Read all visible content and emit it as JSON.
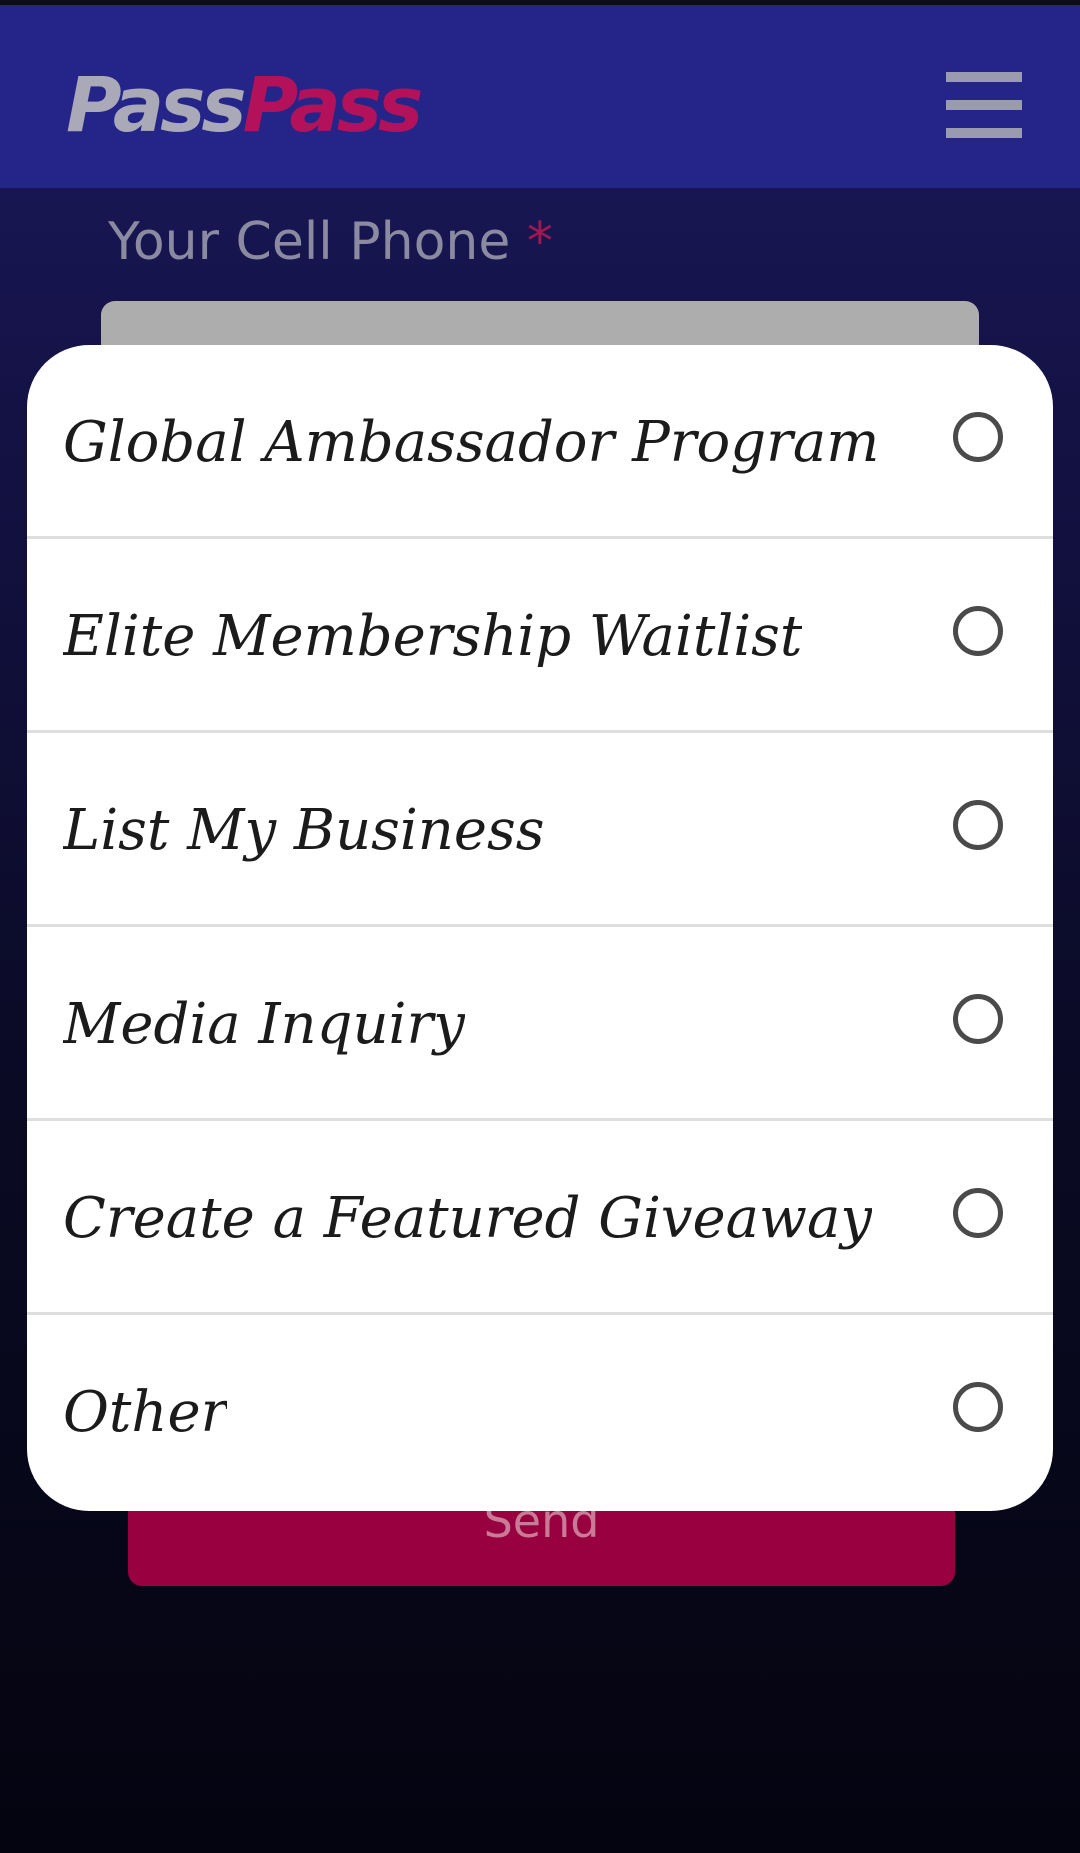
{
  "header": {
    "logo_part1": "Pass",
    "logo_part2": "Pass",
    "colors": {
      "header_bg": "#252589",
      "logo_gray": "#a9a9b8",
      "logo_accent": "#b3125a"
    }
  },
  "form": {
    "phone_label": "Your Cell Phone",
    "required_marker": "*",
    "phone_value": "",
    "send_label": "Send",
    "send_color": "#980040"
  },
  "picker": {
    "options": [
      {
        "label": "Global Ambassador Program",
        "selected": false
      },
      {
        "label": "Elite Membership Waitlist",
        "selected": false
      },
      {
        "label": "List My Business",
        "selected": false
      },
      {
        "label": "Media Inquiry",
        "selected": false
      },
      {
        "label": "Create a Featured Giveaway",
        "selected": false
      },
      {
        "label": "Other",
        "selected": false
      }
    ]
  },
  "icons": {
    "menu": "hamburger-menu-icon",
    "radio": "radio-unchecked-icon"
  }
}
